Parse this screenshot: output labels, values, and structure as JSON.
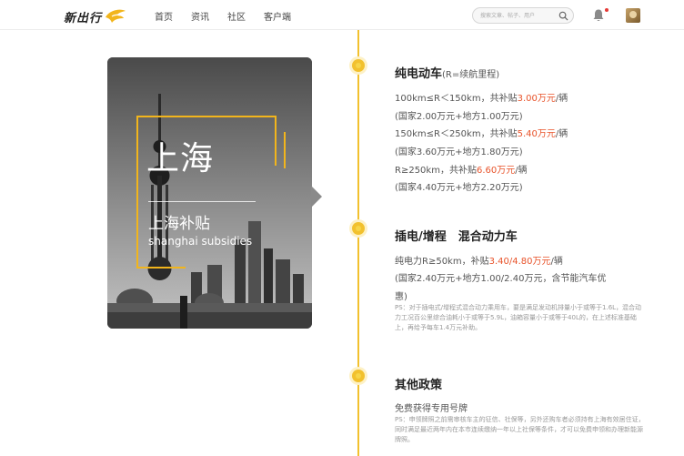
{
  "nav": {
    "logo_text": "新出行",
    "links": [
      "首页",
      "资讯",
      "社区",
      "客户端"
    ],
    "search_placeholder": "搜索文章、帖子、用户",
    "icons": {
      "search": "search-icon",
      "bell": "bell-icon",
      "avatar": "avatar"
    },
    "accent": "#f2b51c",
    "notification_dot": "#e53935"
  },
  "card": {
    "title": "上海",
    "subtitle": "上海补贴",
    "subtitle_en": "shanghai subsidies"
  },
  "sections": [
    {
      "title": "纯电动车",
      "title_note": "(R=续航里程)",
      "lines": [
        {
          "pre": "100km≤R＜150km，共补贴",
          "hl": "3.00万元",
          "post": "/辆"
        },
        {
          "pre": "(国家2.00万元+地方1.00万元)",
          "hl": "",
          "post": ""
        },
        {
          "pre": "150km≤R＜250km，共补贴",
          "hl": "5.40万元",
          "post": "/辆"
        },
        {
          "pre": "(国家3.60万元+地方1.80万元)",
          "hl": "",
          "post": ""
        },
        {
          "pre": "R≥250km，共补贴",
          "hl": "6.60万元",
          "post": "/辆"
        },
        {
          "pre": "(国家4.40万元+地方2.20万元)",
          "hl": "",
          "post": ""
        }
      ]
    },
    {
      "title": "插电/增程　混合动力车",
      "lines": [
        {
          "pre": "纯电力R≥50km，补贴",
          "hl": "3.40/4.80万元",
          "post": "/辆"
        },
        {
          "pre": "(国家2.40万元+地方1.00/2.40万元，含节能汽车优",
          "hl": "",
          "post": ""
        },
        {
          "pre": "惠)",
          "hl": "",
          "post": ""
        }
      ],
      "note": "PS：对于插电式/增程式混合动力乘用车，要是满足发动机排量小于或等于1.6L，混合动力工况百公里综合油耗小于或等于5.9L，油箱容量小于或等于40L的，在上述标准基础上，再给予每车1.4万元补助。"
    },
    {
      "title": "其他政策",
      "lines": [
        {
          "pre": "免费获得专用号牌",
          "hl": "",
          "post": ""
        }
      ],
      "note": "PS：申领牌照之前需审核车主的征信、社保等，另外还购车者必须持有上海有效居住证，同时满足最近两年内在本市连续缴纳一年以上社保等条件，才可以免费申领和办理新能源牌照。"
    }
  ],
  "colors": {
    "highlight": "#e8532a",
    "timeline": "#f2c12e"
  }
}
